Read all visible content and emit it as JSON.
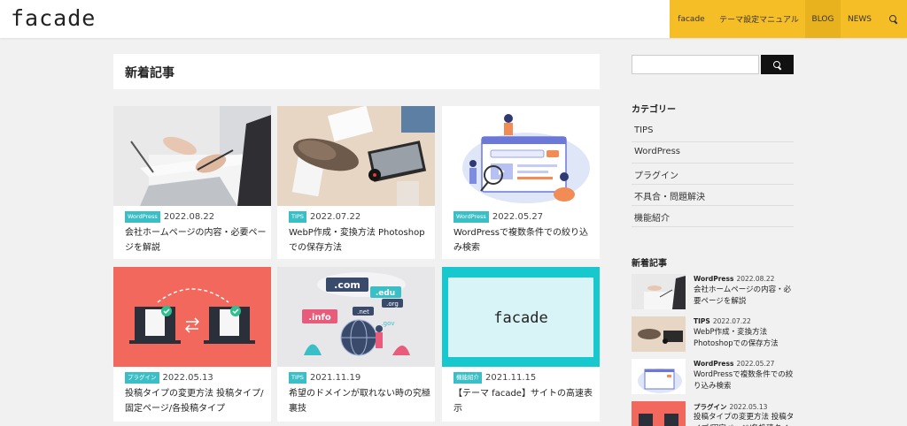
{
  "header": {
    "logo_text": "facade",
    "nav": [
      "facade",
      "テーマ設定マニュアル",
      "BLOG",
      "NEWS"
    ],
    "nav_active": "BLOG"
  },
  "main": {
    "title": "新着記事",
    "cards": [
      {
        "category": "WordPress",
        "date": "2022.08.22",
        "title": "会社ホームページの内容・必要ページを解説"
      },
      {
        "category": "TIPS",
        "date": "2022.07.22",
        "title": "WebP作成・変換方法 Photoshopでの保存方法"
      },
      {
        "category": "WordPress",
        "date": "2022.05.27",
        "title": "WordPressで複数条件での絞り込み検索"
      },
      {
        "category": "プラグイン",
        "date": "2022.05.13",
        "title": "投稿タイプの変更方法 投稿タイプ/固定ページ/各投稿タイプ"
      },
      {
        "category": "TIPS",
        "date": "2021.11.19",
        "title": "希望のドメインが取れない時の究極裏技"
      },
      {
        "category": "機能紹介",
        "date": "2021.11.15",
        "title": "【テーマ facade】サイトの高速表示"
      }
    ],
    "thumb_labels": {
      "com": ".com",
      "edu": ".edu",
      "org": ".org",
      "info": ".info",
      "net": ".net",
      "gov": ".gov",
      "facade": "facade"
    }
  },
  "sidebar": {
    "search_placeholder": "",
    "categories_heading": "カテゴリー",
    "categories": [
      "TIPS",
      "WordPress",
      "プラグイン",
      "不具合・問題解決",
      "機能紹介"
    ],
    "recent_heading": "新着記事",
    "recent": [
      {
        "category": "WordPress",
        "date": "2022.08.22",
        "title": "会社ホームページの内容・必要ページを解説"
      },
      {
        "category": "TIPS",
        "date": "2022.07.22",
        "title": "WebP作成・変換方法 Photoshopでの保存方法"
      },
      {
        "category": "WordPress",
        "date": "2022.05.27",
        "title": "WordPressで複数条件での絞り込み検索"
      },
      {
        "category": "プラグイン",
        "date": "2022.05.13",
        "title": "投稿タイプの変更方法 投稿タイプ/固定ページ/各投稿タイプ"
      }
    ]
  },
  "colors": {
    "accent_yellow": "#f5be27",
    "badge_teal": "#3bbfc6",
    "coral": "#f2685c",
    "cyan": "#17c9cf"
  }
}
